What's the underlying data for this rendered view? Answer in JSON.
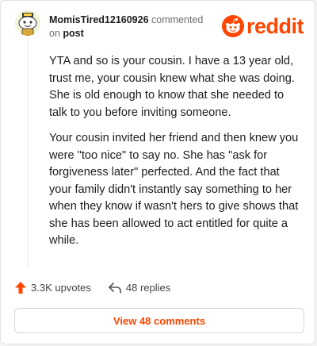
{
  "comment": {
    "author": "MomisTired12160926",
    "action_text": "commented",
    "on_text": "on",
    "post_link": "post",
    "paragraphs": [
      "YTA and so is your cousin. I have a 13 year old, trust me, your cousin knew what she was doing. She is old enough to know that she needed to talk to you before inviting someone.",
      "Your cousin invited her friend and then knew you were \"too nice\" to say no. She has \"ask for forgiveness later\" perfected. And the fact that your family didn't instantly say something to her when they know if wasn't hers to give shows that she has been allowed to act entitled for quite a while."
    ]
  },
  "brand": {
    "name": "reddit",
    "color": "#ff4500"
  },
  "actions": {
    "upvotes": "3.3K upvotes",
    "replies": "48 replies",
    "upvote_icon": "upvote-arrow-icon",
    "reply_icon": "reply-arrow-icon"
  },
  "footer": {
    "view_comments": "View 48 comments"
  }
}
